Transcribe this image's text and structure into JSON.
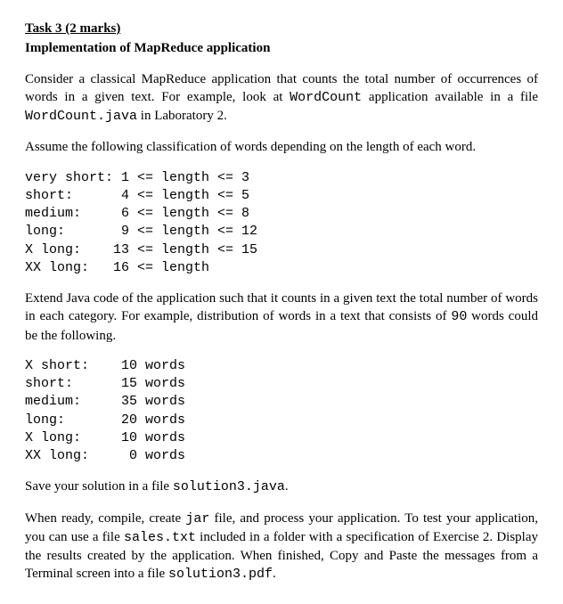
{
  "title": "Task 3 (2 marks)",
  "subtitle": "Implementation of MapReduce application",
  "para1_a": "Consider a classical MapReduce application that counts the total number of occurrences of words in a given text. For example, look at ",
  "para1_code1": "WordCount",
  "para1_b": " application available in a file ",
  "para1_code2": "WordCount.java",
  "para1_c": " in Laboratory 2.",
  "para2": "Assume the following classification of words depending on the length of each word.",
  "classification": "very short: 1 <= length <= 3\nshort:      4 <= length <= 5\nmedium:     6 <= length <= 8\nlong:       9 <= length <= 12\nX long:    13 <= length <= 15\nXX long:   16 <= length",
  "para3_a": "Extend Java code of the application such that it counts in a given text the total number of words in each category. For example, distribution of words in a text that consists of ",
  "para3_code1": "90",
  "para3_b": " words could be the following.",
  "distribution": "X short:    10 words\nshort:      15 words\nmedium:     35 words\nlong:       20 words\nX long:     10 words\nXX long:     0 words",
  "para4_a": "Save your solution in a file ",
  "para4_code1": "solution3.java",
  "para4_b": ".",
  "para5_a": "When ready, compile, create ",
  "para5_code1": "jar",
  "para5_b": " file, and process your application. To test your application, you can use a file ",
  "para5_code2": "sales.txt",
  "para5_c": " included in a folder with a specification of Exercise 2. Display the results created by the application. When finished, Copy and Paste the messages from a Terminal screen into a file ",
  "para5_code3": "solution3.pdf",
  "para5_d": "."
}
